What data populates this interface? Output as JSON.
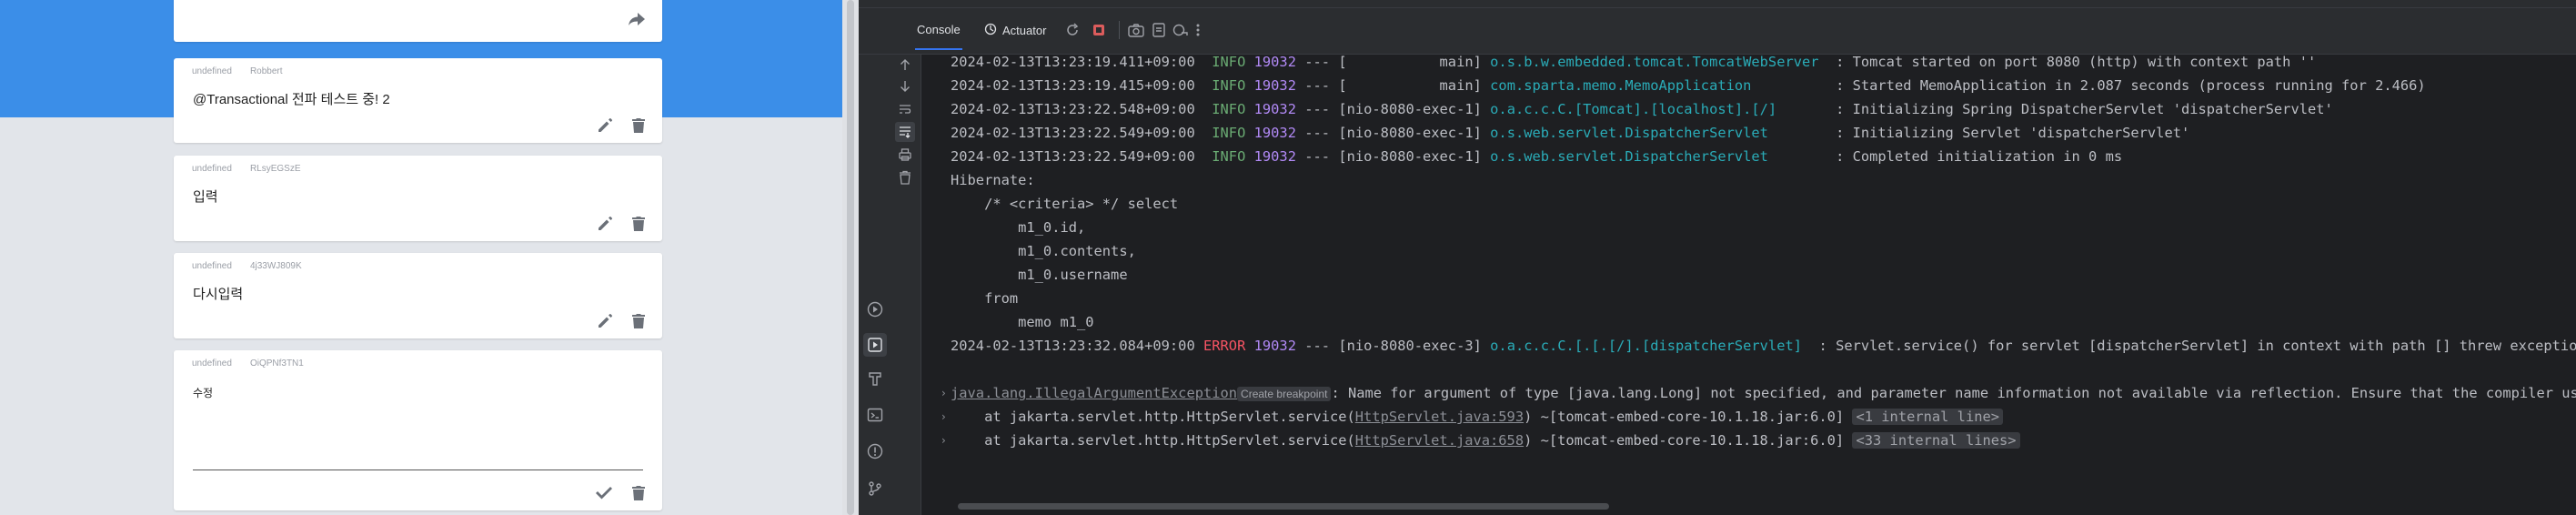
{
  "memo_app": {
    "cards": [
      {
        "username": "",
        "id": "",
        "text": "",
        "action": "share"
      },
      {
        "username": "undefined",
        "id": "Robbert",
        "text": "@Transactional 전파 테스트 중! 2",
        "action": "edit"
      },
      {
        "username": "undefined",
        "id": "RLsyEGSzE",
        "text": "입력",
        "action": "edit"
      },
      {
        "username": "undefined",
        "id": "4j33WJ809K",
        "text": "다시입력",
        "action": "edit"
      },
      {
        "username": "undefined",
        "id": "OiQPNf3TN1",
        "text": "수정",
        "action": "editing"
      }
    ],
    "icons": {
      "edit": "pencil-icon",
      "delete": "trash-icon",
      "share": "share-icon",
      "confirm": "check-icon"
    }
  },
  "ide": {
    "tabs": {
      "console": "Console",
      "actuator": "Actuator"
    },
    "toolbar_icons": [
      "rerun-icon",
      "stop-icon",
      "camera-icon",
      "export-icon",
      "link-icon",
      "more-icon"
    ],
    "gutter_icons": [
      "arrow-up-icon",
      "arrow-down-icon",
      "soft-wrap-icon",
      "scroll-to-end-icon",
      "print-icon",
      "trash-icon"
    ],
    "side_icons": [
      "run-icon",
      "debug-icon",
      "build-icon",
      "terminal-icon",
      "problems-icon",
      "git-icon"
    ],
    "log": [
      {
        "time": "2024-02-13T13:23:19.411+09:00",
        "level": "INFO",
        "pid": "19032",
        "sep": "---",
        "thread": "[           main]",
        "logger": "o.s.b.w.embedded.tomcat.TomcatWebServer",
        "msg": ": Tomcat started on port 8080 (http) with context path ''"
      },
      {
        "time": "2024-02-13T13:23:19.415+09:00",
        "level": "INFO",
        "pid": "19032",
        "sep": "---",
        "thread": "[           main]",
        "logger": "com.sparta.memo.MemoApplication",
        "msg": ": Started MemoApplication in 2.087 seconds (process running for 2.466)"
      },
      {
        "time": "2024-02-13T13:23:22.548+09:00",
        "level": "INFO",
        "pid": "19032",
        "sep": "---",
        "thread": "[nio-8080-exec-1]",
        "logger": "o.a.c.c.C.[Tomcat].[localhost].[/]",
        "msg": ": Initializing Spring DispatcherServlet 'dispatcherServlet'"
      },
      {
        "time": "2024-02-13T13:23:22.549+09:00",
        "level": "INFO",
        "pid": "19032",
        "sep": "---",
        "thread": "[nio-8080-exec-1]",
        "logger": "o.s.web.servlet.DispatcherServlet",
        "msg": ": Initializing Servlet 'dispatcherServlet'"
      },
      {
        "time": "2024-02-13T13:23:22.549+09:00",
        "level": "INFO",
        "pid": "19032",
        "sep": "---",
        "thread": "[nio-8080-exec-1]",
        "logger": "o.s.web.servlet.DispatcherServlet",
        "msg": ": Completed initialization in 0 ms"
      }
    ],
    "sql": [
      "Hibernate:",
      "    /* <criteria> */ select",
      "        m1_0.id,",
      "        m1_0.contents,",
      "        m1_0.username",
      "    from",
      "        memo m1_0"
    ],
    "error_line": {
      "time": "2024-02-13T13:23:32.084+09:00",
      "level": "ERROR",
      "pid": "19032",
      "sep": "---",
      "thread": "[nio-8080-exec-3]",
      "logger": "o.a.c.c.C.[.[.[/].[dispatcherServlet]",
      "msg": "  : Servlet.service() for servlet [dispatcherServlet] in context with path [] threw exception ["
    },
    "exception": {
      "class": "java.lang.IllegalArgumentException",
      "badge": "Create breakpoint",
      "msg": ": Name for argument of type [java.lang.Long] not specified, and parameter name information not available via reflection. Ensure that the compiler uses"
    },
    "stack": [
      {
        "prefix": "    at jakarta.servlet.http.HttpServlet.service(",
        "link": "HttpServlet.java:593",
        "suffix": ") ~[tomcat-embed-core-10.1.18.jar:6.0]",
        "internal": "<1 internal line>"
      },
      {
        "prefix": "    at jakarta.servlet.http.HttpServlet.service(",
        "link": "HttpServlet.java:658",
        "suffix": ") ~[tomcat-embed-core-10.1.18.jar:6.0]",
        "internal": "<33 internal lines>"
      }
    ]
  }
}
